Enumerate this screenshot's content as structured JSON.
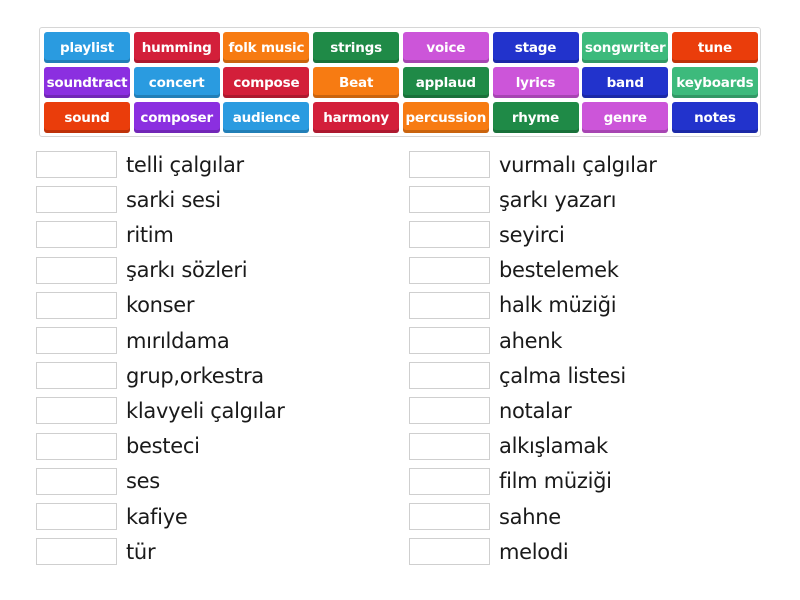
{
  "colors": {
    "blue": "#2a9be0",
    "red": "#d31f3a",
    "orange": "#f77b12",
    "green": "#1f8a47",
    "pink": "#cc55d9",
    "navy": "#2233cc",
    "teal": "#3dba7c",
    "redorange": "#ea3d0b",
    "purple": "#8b2fe0"
  },
  "word_bank": [
    {
      "label": "playlist",
      "color": "blue"
    },
    {
      "label": "humming",
      "color": "red"
    },
    {
      "label": "folk music",
      "color": "orange"
    },
    {
      "label": "strings",
      "color": "green"
    },
    {
      "label": "voice",
      "color": "pink"
    },
    {
      "label": "stage",
      "color": "navy"
    },
    {
      "label": "songwriter",
      "color": "teal"
    },
    {
      "label": "tune",
      "color": "redorange"
    },
    {
      "label": "soundtract",
      "color": "purple"
    },
    {
      "label": "concert",
      "color": "blue"
    },
    {
      "label": "compose",
      "color": "red"
    },
    {
      "label": "Beat",
      "color": "orange"
    },
    {
      "label": "applaud",
      "color": "green"
    },
    {
      "label": "lyrics",
      "color": "pink"
    },
    {
      "label": "band",
      "color": "navy"
    },
    {
      "label": "keyboards",
      "color": "teal"
    },
    {
      "label": "sound",
      "color": "redorange"
    },
    {
      "label": "composer",
      "color": "purple"
    },
    {
      "label": "audience",
      "color": "blue"
    },
    {
      "label": "harmony",
      "color": "red"
    },
    {
      "label": "percussion",
      "color": "orange"
    },
    {
      "label": "rhyme",
      "color": "green"
    },
    {
      "label": "genre",
      "color": "pink"
    },
    {
      "label": "notes",
      "color": "navy"
    }
  ],
  "left_column": [
    {
      "answer": "",
      "label": "telli çalgılar"
    },
    {
      "answer": "",
      "label": "sarki sesi"
    },
    {
      "answer": "",
      "label": "ritim"
    },
    {
      "answer": "",
      "label": "şarkı sözleri"
    },
    {
      "answer": "",
      "label": "konser"
    },
    {
      "answer": "",
      "label": "mırıldama"
    },
    {
      "answer": "",
      "label": "grup,orkestra"
    },
    {
      "answer": "",
      "label": "klavyeli çalgılar"
    },
    {
      "answer": "",
      "label": "besteci"
    },
    {
      "answer": "",
      "label": "ses"
    },
    {
      "answer": "",
      "label": "kafiye"
    },
    {
      "answer": "",
      "label": "tür"
    }
  ],
  "right_column": [
    {
      "answer": "",
      "label": "vurmalı çalgılar"
    },
    {
      "answer": "",
      "label": "şarkı yazarı"
    },
    {
      "answer": "",
      "label": "seyirci"
    },
    {
      "answer": "",
      "label": "bestelemek"
    },
    {
      "answer": "",
      "label": "halk müziği"
    },
    {
      "answer": "",
      "label": "ahenk"
    },
    {
      "answer": "",
      "label": "çalma listesi"
    },
    {
      "answer": "",
      "label": "notalar"
    },
    {
      "answer": "",
      "label": "alkışlamak"
    },
    {
      "answer": "",
      "label": "film müziği"
    },
    {
      "answer": "",
      "label": "sahne"
    },
    {
      "answer": "",
      "label": "melodi"
    }
  ]
}
